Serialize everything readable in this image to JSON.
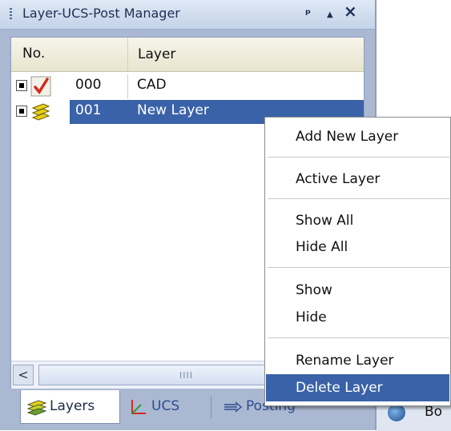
{
  "panel": {
    "title": "Layer-UCS-Post Manager",
    "pin_glyph": "ᵖ",
    "up_glyph": "▲",
    "close_glyph": "×"
  },
  "columns": {
    "no": "No.",
    "layer": "Layer"
  },
  "rows": [
    {
      "no": "000",
      "layer": "CAD",
      "icon": "active-check-icon"
    },
    {
      "no": "001",
      "layer": "New Layer",
      "icon": "layer-stack-icon",
      "selected": true
    }
  ],
  "scrollbar": {
    "left_arrow": "<",
    "grip": "IIII"
  },
  "tabs": {
    "layers": "Layers",
    "ucs": "UCS",
    "posting": "Posting"
  },
  "background_app": {
    "label": "Bo"
  },
  "context_menu": {
    "add_new_layer": "Add New Layer",
    "active_layer": "Active Layer",
    "show_all": "Show All",
    "hide_all": "Hide All",
    "show": "Show",
    "hide": "Hide",
    "rename_layer": "Rename Layer",
    "delete_layer": "Delete Layer",
    "highlighted": "Delete Layer"
  },
  "colors": {
    "selection": "#3a62a8",
    "panel_frame": "#aab8d2",
    "check_red": "#d42a1c",
    "layer_yellow": "#e8d21a"
  }
}
